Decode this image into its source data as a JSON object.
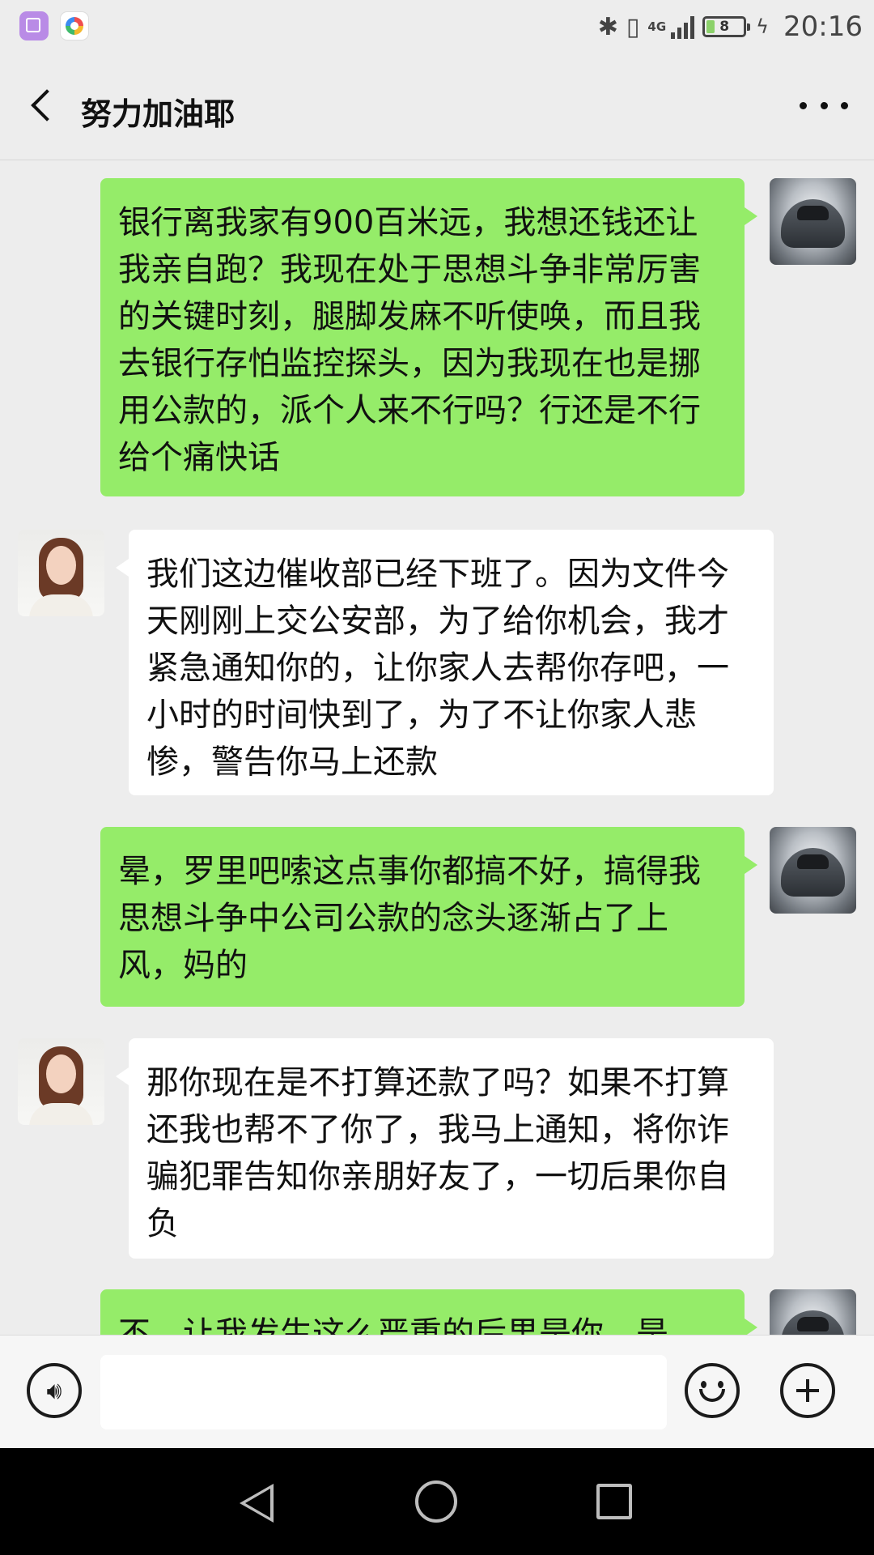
{
  "status_bar": {
    "network": "4G",
    "battery_level": "8",
    "time": "20:16",
    "icons": [
      "gallery-icon",
      "photos-icon",
      "bluetooth-icon",
      "vibrate-icon",
      "signal-icon",
      "battery-icon",
      "charging-icon"
    ]
  },
  "header": {
    "title": "努力加油耶",
    "back_icon": "chevron-left-icon",
    "more_icon": "more-dots-icon"
  },
  "messages": [
    {
      "side": "out",
      "avatar": "sports-car-avatar",
      "text": "银行离我家有900百米远，我想还钱还让我亲自跑？我现在处于思想斗争非常厉害的关键时刻，腿脚发麻不听使唤，而且我去银行存怕监控探头，因为我现在也是挪用公款的，派个人来不行吗？行还是不行给个痛快话"
    },
    {
      "side": "in",
      "avatar": "woman-portrait-avatar",
      "text": "我们这边催收部已经下班了。因为文件今天刚刚上交公安部，为了给你机会，我才紧急通知你的，让你家人去帮你存吧，一小时的时间快到了，为了不让你家人悲惨，警告你马上还款"
    },
    {
      "side": "out",
      "avatar": "sports-car-avatar",
      "text": "晕，罗里吧嗦这点事你都搞不好，搞得我思想斗争中公司公款的念头逐渐占了上风，妈的"
    },
    {
      "side": "in",
      "avatar": "woman-portrait-avatar",
      "text": "那你现在是不打算还款了吗？如果不打算还我也帮不了你了，我马上通知，将你诈骗犯罪告知你亲朋好友了，一切后果你自负"
    },
    {
      "side": "out",
      "avatar": "sports-car-avatar",
      "text": "不，让我发生这么严重的后果是你，是"
    }
  ],
  "input_bar": {
    "placeholder": "",
    "icons": [
      "voice-icon",
      "emoji-icon",
      "plus-icon"
    ]
  },
  "nav_bar": {
    "icons": [
      "nav-back-icon",
      "nav-home-icon",
      "nav-recent-icon"
    ]
  },
  "colors": {
    "background": "#ededed",
    "outgoing_bubble": "#95ec69",
    "incoming_bubble": "#ffffff",
    "nav_background": "#000000"
  }
}
